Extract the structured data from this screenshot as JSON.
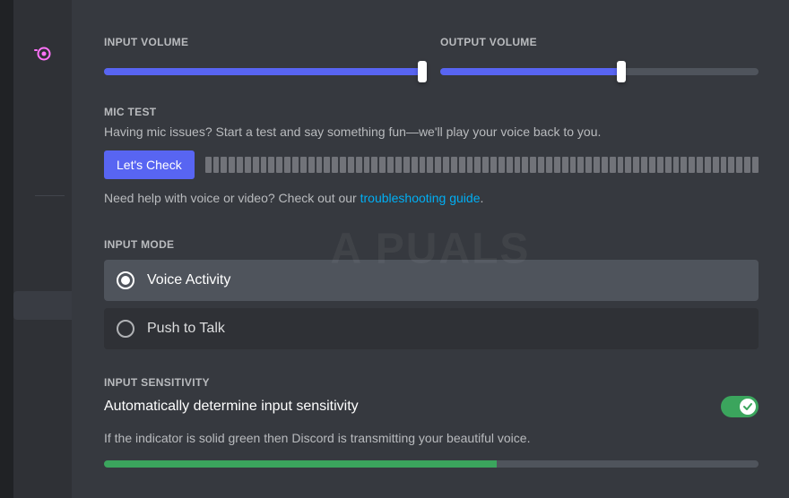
{
  "sliders": {
    "input_label": "INPUT VOLUME",
    "output_label": "OUTPUT VOLUME",
    "input_percent": 100,
    "output_percent": 57
  },
  "mic_test": {
    "heading": "MIC TEST",
    "description": "Having mic issues? Start a test and say something fun—we'll play your voice back to you.",
    "button_label": "Let's Check",
    "help_prefix": "Need help with voice or video? Check out our ",
    "help_link_text": "troubleshooting guide"
  },
  "input_mode": {
    "heading": "INPUT MODE",
    "options": [
      {
        "label": "Voice Activity",
        "selected": true
      },
      {
        "label": "Push to Talk",
        "selected": false
      }
    ]
  },
  "sensitivity": {
    "heading": "INPUT SENSITIVITY",
    "toggle_label": "Automatically determine input sensitivity",
    "toggle_on": true,
    "help_text": "If the indicator is solid green then Discord is transmitting your beautiful voice."
  },
  "watermark": "A   PUALS"
}
